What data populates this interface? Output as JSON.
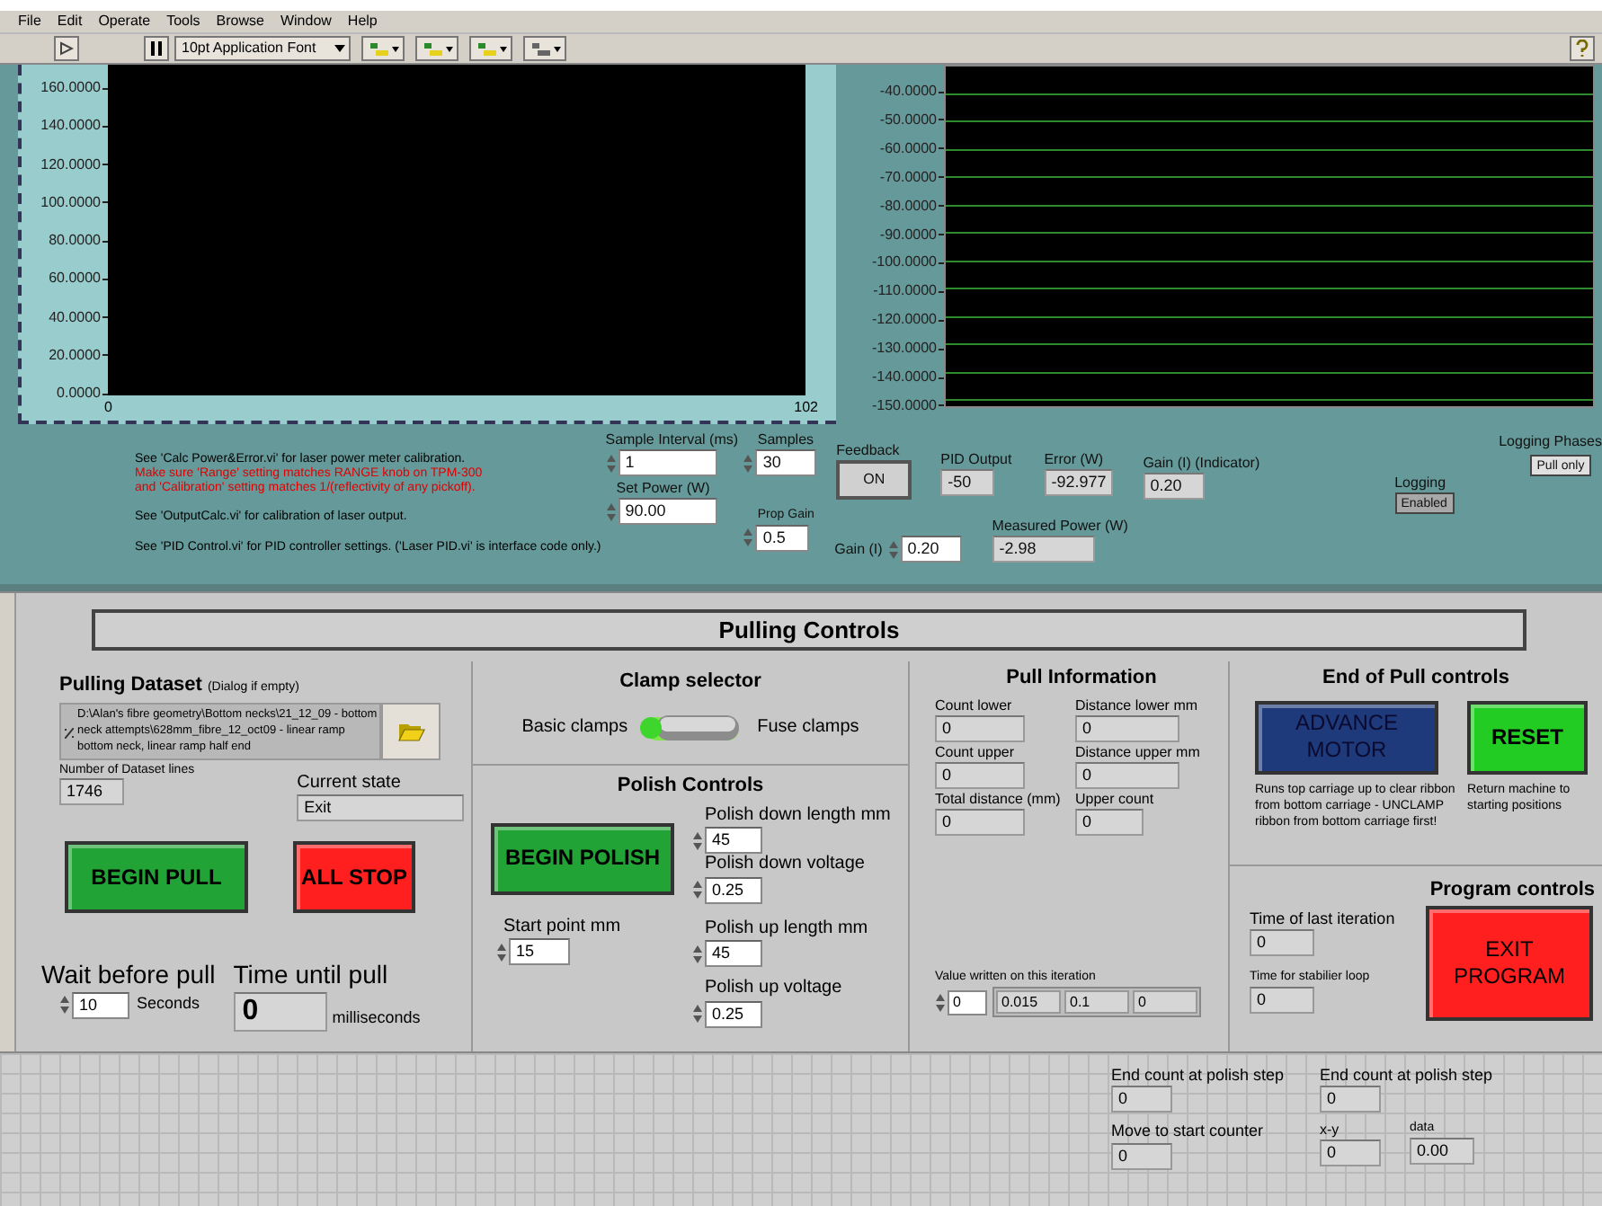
{
  "menu": [
    "File",
    "Edit",
    "Operate",
    "Tools",
    "Browse",
    "Window",
    "Help"
  ],
  "toolbar": {
    "font": "10pt Application Font"
  },
  "left_chart": {
    "yticks": [
      "160.0000",
      "140.0000",
      "120.0000",
      "100.0000",
      "80.0000",
      "60.0000",
      "40.0000",
      "20.0000",
      "0.0000"
    ],
    "xticks": [
      "0",
      "102"
    ]
  },
  "right_chart": {
    "yticks": [
      "-40.0000",
      "-50.0000",
      "-60.0000",
      "-70.0000",
      "-80.0000",
      "-90.0000",
      "-100.0000",
      "-110.0000",
      "-120.0000",
      "-130.0000",
      "-140.0000",
      "-150.0000"
    ]
  },
  "notes": [
    {
      "text": "See 'Calc Power&Error.vi' for laser power meter calibration.",
      "color": "#000000"
    },
    {
      "text": "Make sure 'Range' setting matches RANGE knob on TPM-300",
      "color": "#e00000"
    },
    {
      "text": "and 'Calibration' setting matches 1/(reflectivity of any pickoff).",
      "color": "#e00000"
    },
    {
      "text": "See 'OutputCalc.vi' for calibration of laser output.",
      "color": "#000000"
    },
    {
      "text": "See 'PID Control.vi' for PID controller settings. ('Laser PID.vi' is interface code only.)",
      "color": "#000000"
    }
  ],
  "sample_interval": {
    "label": "Sample Interval (ms)",
    "value": "1",
    "kind": "control"
  },
  "set_power": {
    "label": "Set Power (W)",
    "value": "90.00",
    "kind": "control"
  },
  "samples": {
    "label": "Samples",
    "value": "30",
    "kind": "control"
  },
  "prop_gain": {
    "label": "Prop Gain",
    "value": "0.5",
    "kind": "control"
  },
  "feedback": {
    "label": "Feedback",
    "text": "ON"
  },
  "pid_output": {
    "label": "PID Output",
    "value": "-50",
    "kind": "indicator"
  },
  "error": {
    "label": "Error (W)",
    "value": "-92.977",
    "kind": "indicator"
  },
  "gain_indicator": {
    "label": "Gain (I) (Indicator)",
    "value": "0.20",
    "kind": "indicator"
  },
  "gain_i": {
    "label": "Gain (I)",
    "value": "0.20",
    "kind": "control"
  },
  "measured_power": {
    "label": "Measured Power (W)",
    "value": "-2.98",
    "kind": "indicator"
  },
  "logging": {
    "label": "Logging",
    "text": "Enabled"
  },
  "logging_phases": {
    "label": "Logging Phases",
    "text": "Pull only"
  },
  "title": "Pulling Controls",
  "dataset": {
    "label": "Pulling Dataset",
    "hint": "(Dialog if empty)",
    "path": "D:\\Alan's fibre geometry\\Bottom necks\\21_12_09 - bottom neck attempts\\628mm_fibre_12_oct09 - linear ramp bottom neck, linear ramp half end"
  },
  "dataset_lines": {
    "label": "Number of Dataset lines",
    "value": "1746",
    "kind": "indicator"
  },
  "current_state": {
    "label": "Current state",
    "value": "Exit",
    "kind": "indicator"
  },
  "begin_pull": {
    "text": "BEGIN PULL",
    "color": "#22a336"
  },
  "all_stop": {
    "text": "ALL STOP",
    "color": "#ff1f1f"
  },
  "wait_before_pull": {
    "label": "Wait before pull",
    "value": "10",
    "unit": "Seconds",
    "kind": "control"
  },
  "time_until_pull": {
    "label": "Time until pull",
    "value": "0",
    "unit": "milliseconds",
    "kind": "indicator"
  },
  "clamp": {
    "title": "Clamp selector",
    "left": "Basic clamps",
    "right": "Fuse clamps",
    "on": true
  },
  "polish": {
    "title": "Polish Controls",
    "button": {
      "text": "BEGIN POLISH",
      "color": "#22a336"
    },
    "start_point": {
      "label": "Start point mm",
      "value": "15",
      "kind": "control"
    },
    "fields": [
      {
        "label": "Polish down length mm",
        "value": "45",
        "kind": "control"
      },
      {
        "label": "Polish down voltage",
        "value": "0.25",
        "kind": "control"
      },
      {
        "label": "Polish up length mm",
        "value": "45",
        "kind": "control"
      },
      {
        "label": "Polish up voltage",
        "value": "0.25",
        "kind": "control"
      }
    ]
  },
  "pull_info": {
    "title": "Pull Information",
    "fields": [
      {
        "label": "Count lower",
        "value": "0",
        "kind": "indicator"
      },
      {
        "label": "Distance lower mm",
        "value": "0",
        "kind": "indicator"
      },
      {
        "label": "Count upper",
        "value": "0",
        "kind": "indicator"
      },
      {
        "label": "Distance upper mm",
        "value": "0",
        "kind": "indicator"
      },
      {
        "label": "Total distance (mm)",
        "value": "0",
        "kind": "indicator"
      },
      {
        "label": "Upper count",
        "value": "0",
        "kind": "indicator"
      }
    ],
    "array_label": "Value written on this iteration",
    "array_index": "0",
    "array_values": [
      "0.015",
      "0.1",
      "0"
    ]
  },
  "end_of_pull": {
    "title": "End of Pull controls",
    "advance": {
      "text": "ADVANCE MOTOR",
      "color": "#1f3a7a"
    },
    "advance_note": "Runs top carriage up to clear ribbon from bottom carriage - UNCLAMP ribbon from bottom carriage first!",
    "reset": {
      "text": "RESET",
      "color": "#22cc22"
    },
    "reset_note": "Return machine to starting positions"
  },
  "program": {
    "title": "Program controls",
    "fields": [
      {
        "label": "Time of last iteration",
        "value": "0",
        "kind": "indicator"
      },
      {
        "label": "Time for stabilier loop",
        "value": "0",
        "kind": "indicator"
      }
    ],
    "exit": {
      "text": "EXIT PROGRAM",
      "color": "#ff1f1f"
    }
  },
  "bottom": [
    {
      "label": "End count at polish step",
      "value": "0",
      "kind": "indicator"
    },
    {
      "label": "End count at polish step",
      "value": "0",
      "kind": "indicator"
    },
    {
      "label": "Move to start counter",
      "value": "0",
      "kind": "indicator"
    },
    {
      "label": "x-y",
      "value": "0",
      "kind": "indicator"
    },
    {
      "label": "data",
      "value": "0.00",
      "kind": "indicator"
    }
  ]
}
